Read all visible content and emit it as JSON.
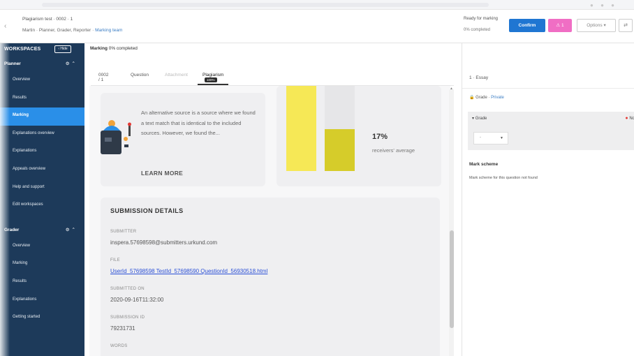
{
  "header": {
    "title": "Plagiarism test · 0002 · 1",
    "roles": "Martin · Planner, Grader, Reporter ·",
    "team_link": "Marking team",
    "ready": "Ready for marking",
    "completed": "0% completed",
    "confirm_label": "Confirm",
    "alert_count": "1",
    "options_label": "Options"
  },
  "sidebar": {
    "workspaces_label": "WORKSPACES",
    "hide_label": "Hide",
    "sections": [
      {
        "title": "Planner",
        "items": [
          "Overview",
          "Results",
          "Marking",
          "Explanations overview",
          "Explanations",
          "Appeals overview",
          "Help and support",
          "Edit workspaces"
        ]
      },
      {
        "title": "Grader",
        "items": [
          "Overview",
          "Marking",
          "Results",
          "Explanations",
          "Getting started"
        ]
      }
    ]
  },
  "main": {
    "marking_label": "Marking",
    "marking_progress": "0% completed",
    "tabs": [
      {
        "label": "0002 / 1"
      },
      {
        "label": "Question"
      },
      {
        "label": "Attachment"
      },
      {
        "label": "Plagiarism",
        "badge": "100%"
      }
    ],
    "info_text": "An alternative source is a source where we found a text match that is identical to the included sources. However, we found the...",
    "learn_more": "LEARN MORE",
    "stat_percent": "17%",
    "stat_label": "receivers' average",
    "submission": {
      "title": "SUBMISSION DETAILS",
      "submitter_label": "SUBMITTER",
      "submitter": "inspera.57698598@submitters.urkund.com",
      "file_label": "FILE",
      "file": "UserId_57698598 TestId_57698590 QuestionId_56930518.html",
      "submitted_on_label": "SUBMITTED ON",
      "submitted_on": "2020-09-16T11:32:00",
      "submission_id_label": "SUBMISSION ID",
      "submission_id": "79231731",
      "words_label": "WORDS"
    }
  },
  "right_panel": {
    "essay": "1 · Essay",
    "grade_prefix": "Grade ·",
    "grade_private": "Private",
    "grade_label": "Grade",
    "not_label": "No",
    "select_placeholder": "-",
    "mark_scheme_title": "Mark scheme",
    "mark_scheme_text": "Mark scheme for this question not found"
  },
  "colors": {
    "sidebar_bg": "#1d3a5a",
    "sidebar_active": "#2a8fe8",
    "confirm_blue": "#1f76d2",
    "alert_pink": "#f06ec4",
    "bar_yellow": "#f6e856",
    "bar_olive": "#d6cc2a",
    "link_blue": "#2a4fd6"
  },
  "icons": [
    "back-chevron-icon",
    "warning-icon",
    "chevron-down-icon",
    "swap-icon",
    "gear-icon",
    "chevron-up-icon",
    "robot-icon",
    "lock-icon",
    "caret-down-icon",
    "dot-icon"
  ]
}
